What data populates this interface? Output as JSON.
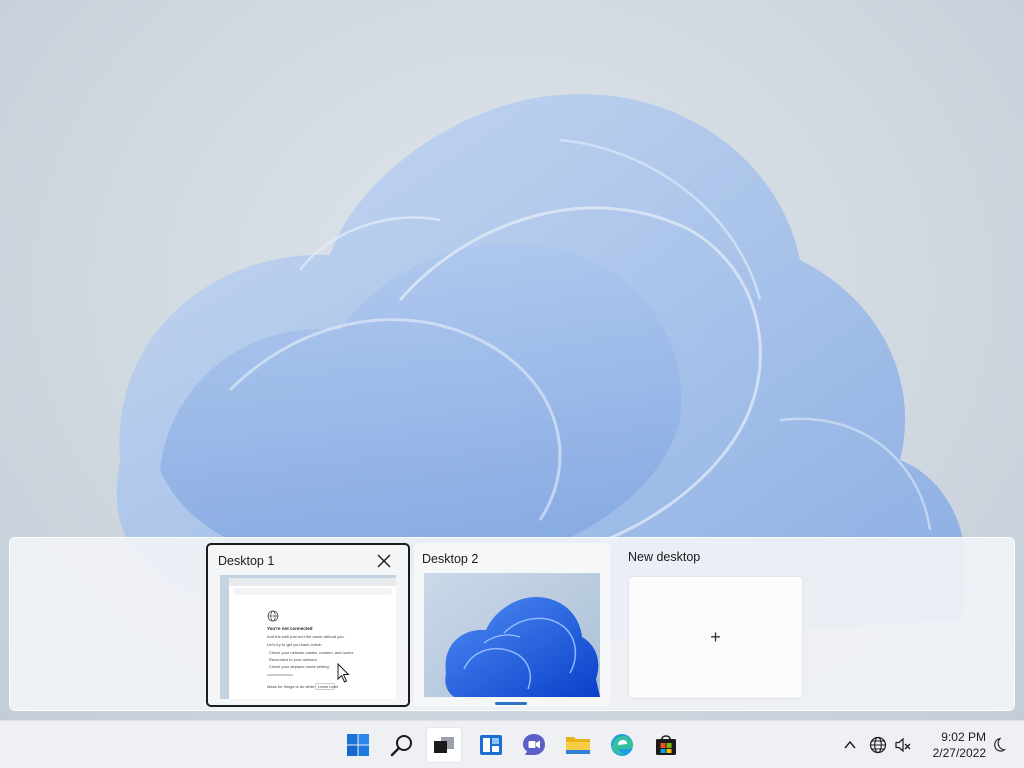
{
  "desktops": [
    {
      "title": "Desktop 1",
      "active": true
    },
    {
      "title": "Desktop 2",
      "active": false
    }
  ],
  "new_desktop": {
    "label": "New desktop",
    "plus": "+"
  },
  "browser_preview": {
    "heading": "You're not connected",
    "subtext": "And the web just isn't the same without you.",
    "lets_try": "Let's try to get you back online:",
    "steps": [
      "Check your network cables, modem, and router.",
      "Reconnect to your network.",
      "Check your airplane mode setting."
    ],
    "footer_note": "Ideas for things to do while offline",
    "footer_button": "Learn more"
  },
  "taskbar": {
    "icons": [
      "windows-start-icon",
      "search-icon",
      "task-view-icon",
      "widgets-icon",
      "teams-chat-icon",
      "file-explorer-icon",
      "edge-browser-icon",
      "microsoft-store-icon"
    ],
    "tray_icons": [
      "chevron-up-icon",
      "network-globe-icon",
      "volume-muted-icon"
    ],
    "time": "9:02 PM",
    "date": "2/27/2022"
  },
  "colors": {
    "accent": "#2f74c4",
    "bloom_light": "#bcd3f1",
    "bloom_dark": "#1f5fd6"
  }
}
